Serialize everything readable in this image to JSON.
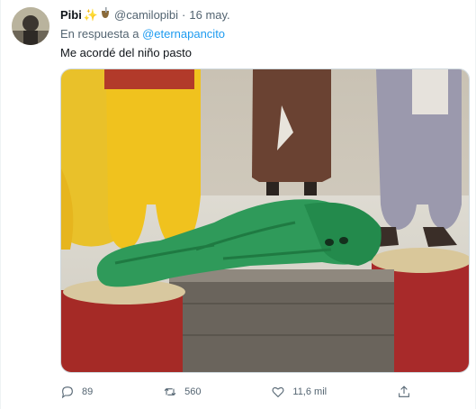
{
  "tweet": {
    "author_name": "Pibi",
    "author_handle": "@camilopibi",
    "separator": "·",
    "date": "16 may.",
    "reply_prefix": "En respuesta a ",
    "reply_to": "@eternapancito",
    "text": "Me acordé del niño pasto"
  },
  "actions": {
    "replies": "89",
    "retweets": "560",
    "likes": "11,6 mil"
  },
  "icons": [
    "reply-icon",
    "retweet-icon",
    "like-icon",
    "share-icon"
  ],
  "colors": {
    "link": "#1d9bf0",
    "muted": "#536471"
  }
}
